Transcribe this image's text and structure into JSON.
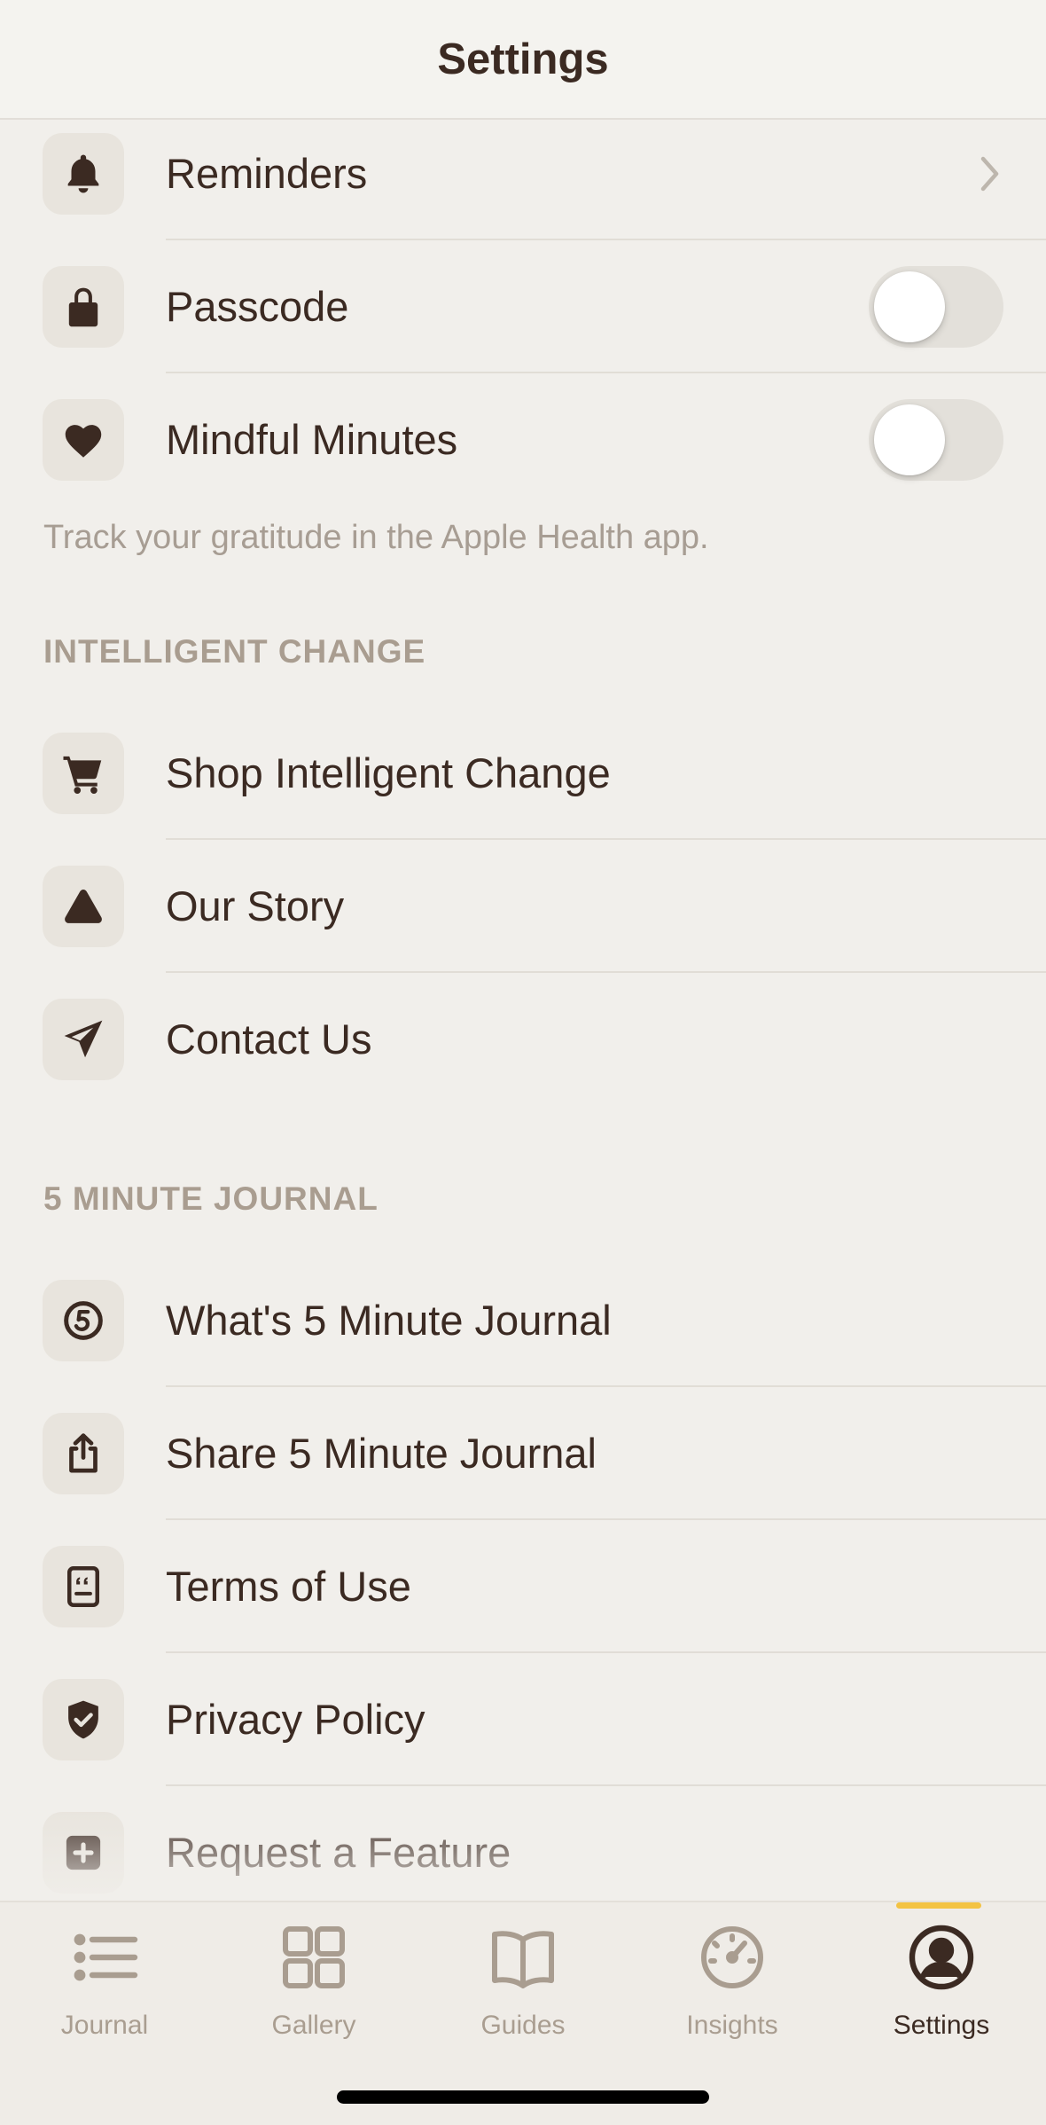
{
  "header": {
    "title": "Settings"
  },
  "general": {
    "items": [
      {
        "label": "Reminders",
        "icon": "bell-icon",
        "accessory": "chevron"
      },
      {
        "label": "Passcode",
        "icon": "lock-icon",
        "accessory": "toggle",
        "on": false
      },
      {
        "label": "Mindful Minutes",
        "icon": "heart-icon",
        "accessory": "toggle",
        "on": false
      }
    ],
    "footnote": "Track your gratitude in the Apple Health app."
  },
  "intelligent_change": {
    "title": "INTELLIGENT CHANGE",
    "items": [
      {
        "label": "Shop Intelligent Change",
        "icon": "cart-icon"
      },
      {
        "label": "Our Story",
        "icon": "triangle-logo-icon"
      },
      {
        "label": "Contact Us",
        "icon": "paper-plane-icon"
      }
    ]
  },
  "journal": {
    "title": "5 MINUTE JOURNAL",
    "items": [
      {
        "label": "What's 5 Minute Journal",
        "icon": "five-circle-icon"
      },
      {
        "label": "Share 5 Minute Journal",
        "icon": "share-icon"
      },
      {
        "label": "Terms of Use",
        "icon": "document-quote-icon"
      },
      {
        "label": "Privacy Policy",
        "icon": "shield-check-icon"
      },
      {
        "label": "Request a Feature",
        "icon": "plus-square-icon"
      }
    ]
  },
  "tabbar": {
    "tabs": [
      {
        "label": "Journal",
        "icon": "list-icon",
        "active": false
      },
      {
        "label": "Gallery",
        "icon": "grid-icon",
        "active": false
      },
      {
        "label": "Guides",
        "icon": "book-icon",
        "active": false
      },
      {
        "label": "Insights",
        "icon": "gauge-icon",
        "active": false
      },
      {
        "label": "Settings",
        "icon": "person-circle-icon",
        "active": true
      }
    ]
  },
  "colors": {
    "background": "#f1efeb",
    "text": "#3b2a22",
    "secondary_text": "#a99d90",
    "icon_tile": "#e8e4dd",
    "accent": "#f3c343"
  }
}
